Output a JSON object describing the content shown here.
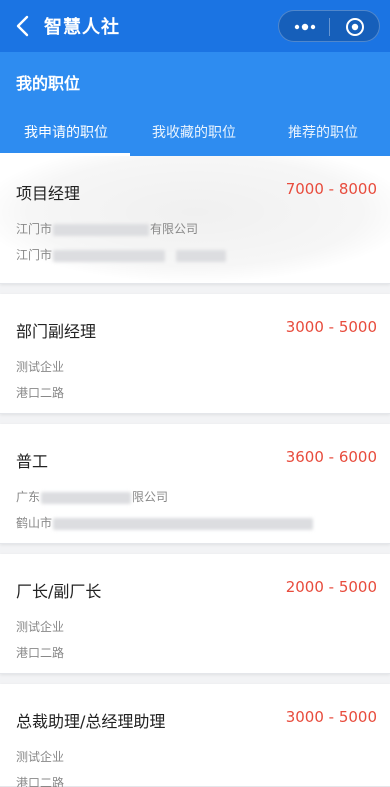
{
  "app": {
    "title": "智慧人社",
    "icons": {
      "back": "back-arrow-icon",
      "more": "more-dots-icon",
      "close": "target-icon"
    }
  },
  "subheader": {
    "title": "我的职位"
  },
  "tabs": [
    {
      "label": "我申请的职位",
      "active": true
    },
    {
      "label": "我收藏的职位",
      "active": false
    },
    {
      "label": "推荐的职位",
      "active": false
    }
  ],
  "jobs": [
    {
      "title": "项目经理",
      "salary": "7000 - 8000",
      "company_prefix": "江门市",
      "company_suffix": "有限公司",
      "address_prefix": "江门市",
      "address_suffix": ""
    },
    {
      "title": "部门副经理",
      "salary": "3000 - 5000",
      "company_prefix": "测试企业",
      "company_suffix": "",
      "address_prefix": "港口二路",
      "address_suffix": ""
    },
    {
      "title": "普工",
      "salary": "3600 - 6000",
      "company_prefix": "广东",
      "company_suffix": "限公司",
      "address_prefix": "鹤山市",
      "address_suffix": ""
    },
    {
      "title": "厂长/副厂长",
      "salary": "2000 - 5000",
      "company_prefix": "测试企业",
      "company_suffix": "",
      "address_prefix": "港口二路",
      "address_suffix": ""
    },
    {
      "title": "总裁助理/总经理助理",
      "salary": "3000 - 5000",
      "company_prefix": "测试企业",
      "company_suffix": "",
      "address_prefix": "港口二路",
      "address_suffix": ""
    }
  ],
  "colors": {
    "topbar": "#1b74e3",
    "subheader": "#2e8cf0",
    "salary": "#e84c3d"
  }
}
